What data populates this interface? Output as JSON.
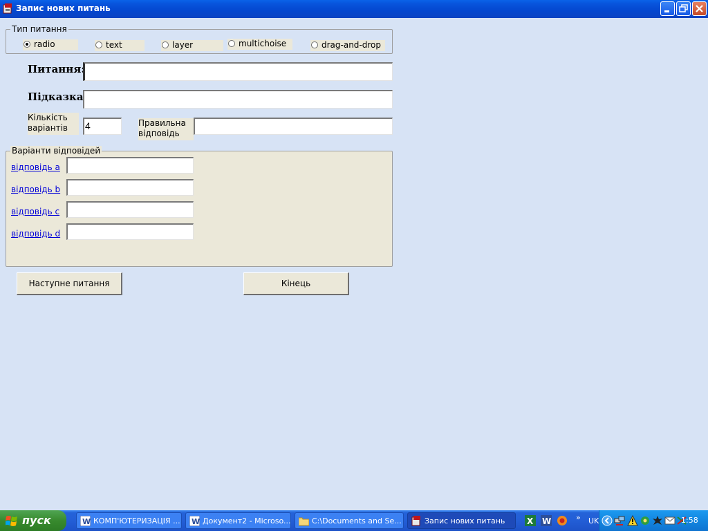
{
  "window": {
    "title": "Запис нових питань"
  },
  "question_type": {
    "legend": "Тип питання",
    "options": [
      "radio",
      "text",
      "layer",
      "multichoise",
      "drag-and-drop"
    ],
    "selected": "radio"
  },
  "form": {
    "question_label": "Питання:",
    "question_value": "",
    "hint_label": "Підказка:",
    "hint_value": "",
    "variant_count_label_line1": "Кількість",
    "variant_count_label_line2": "варіантів",
    "variant_count_value": "4",
    "correct_answer_label_line1": "Правильна",
    "correct_answer_label_line2": "відповідь",
    "correct_answer_value": ""
  },
  "answers": {
    "legend": "Варіанти відповідей",
    "items": [
      {
        "label": "відповідь a",
        "value": ""
      },
      {
        "label": "відповідь b",
        "value": ""
      },
      {
        "label": "відповідь c",
        "value": ""
      },
      {
        "label": "відповідь d",
        "value": ""
      }
    ]
  },
  "buttons": {
    "next": "Наступне питання",
    "finish": "Кінець"
  },
  "taskbar": {
    "start_label": "пуск",
    "tasks": [
      {
        "label": "КОМП'ЮТЕРИЗАЦІЯ ...",
        "icon": "word-icon"
      },
      {
        "label": "Документ2 - Microso...",
        "icon": "word-icon"
      },
      {
        "label": "C:\\Documents and Se...",
        "icon": "folder-icon"
      },
      {
        "label": "Запис нових питань",
        "icon": "app-icon"
      }
    ],
    "quick_chevron": "»",
    "language": "UK",
    "clock": "1:58"
  }
}
